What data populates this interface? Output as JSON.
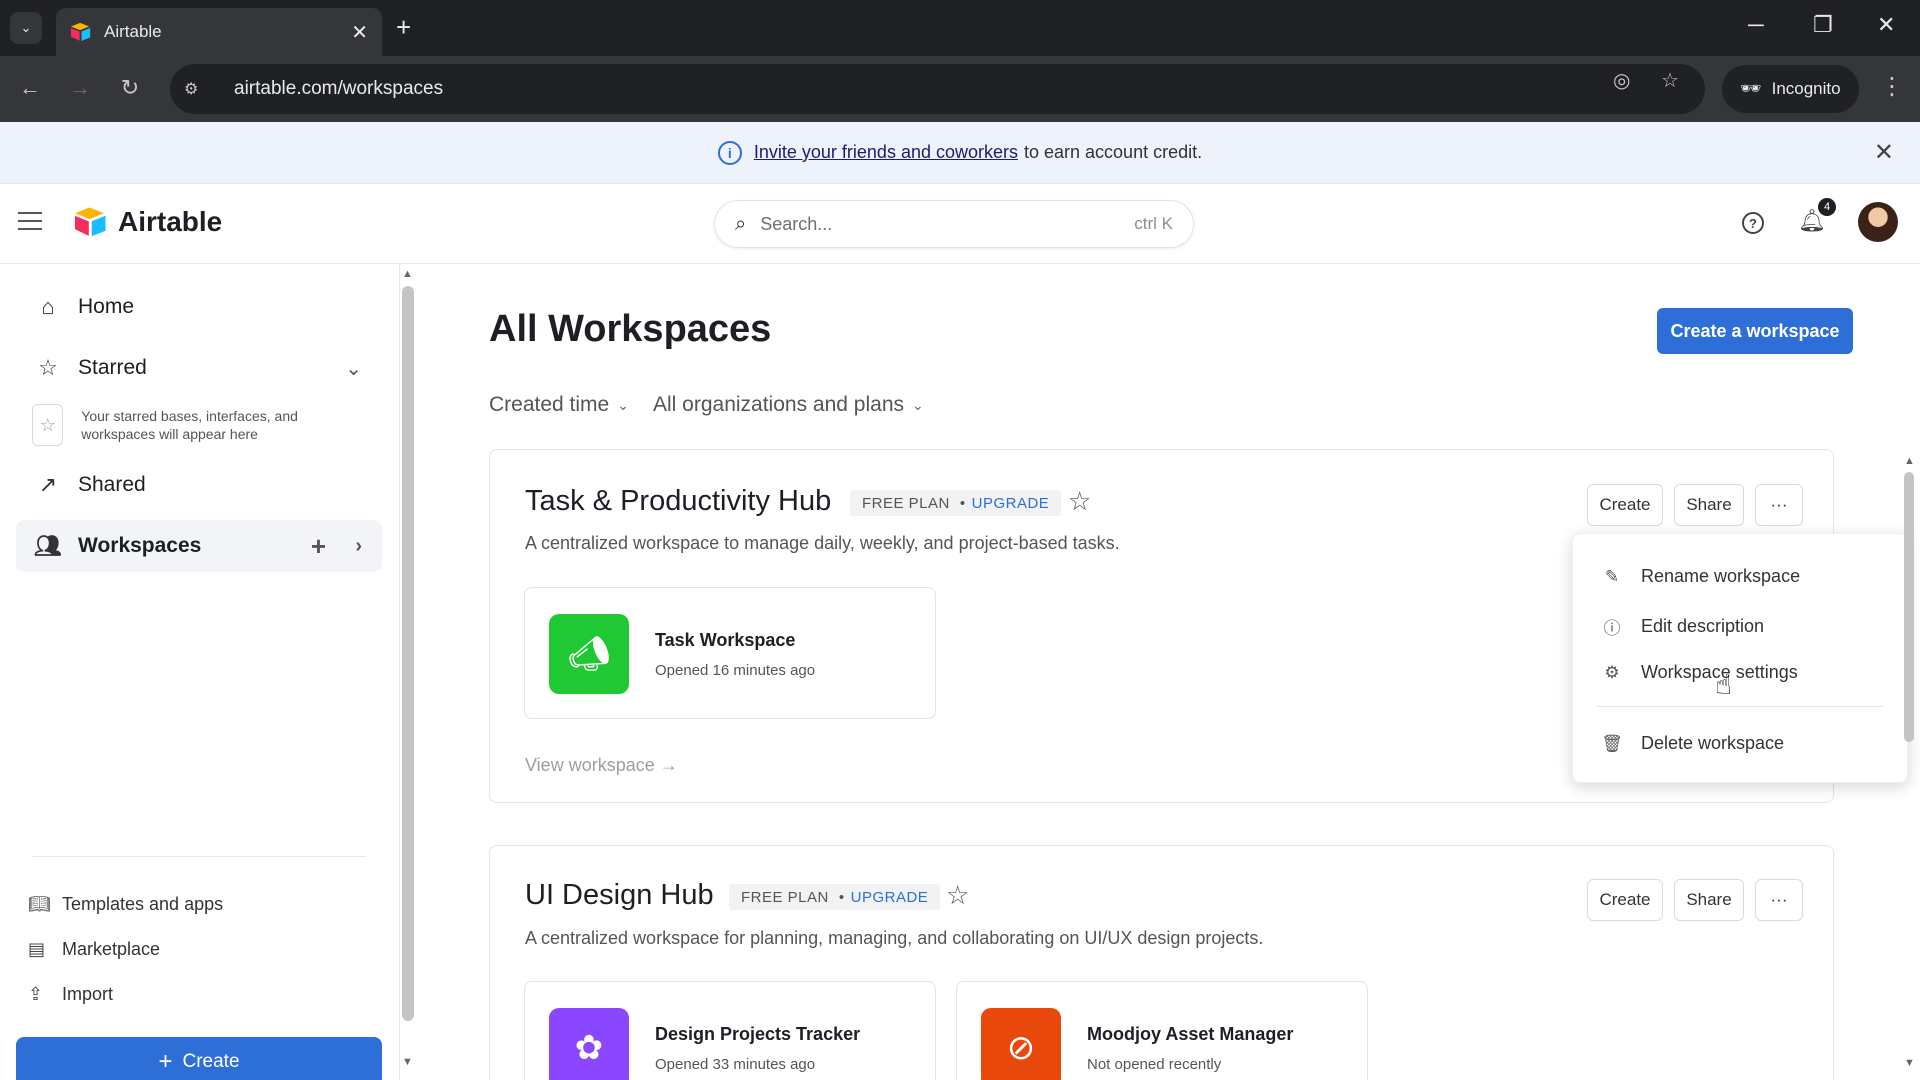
{
  "browser": {
    "tab_title": "Airtable",
    "url": "airtable.com/workspaces",
    "incognito_label": "Incognito"
  },
  "banner": {
    "link_text": "Invite your friends and coworkers",
    "rest_text": "to earn account credit."
  },
  "header": {
    "brand": "Airtable",
    "search_placeholder": "Search...",
    "search_shortcut": "ctrl K",
    "notification_count": "4"
  },
  "sidebar": {
    "home": "Home",
    "starred": "Starred",
    "starred_hint": "Your starred bases, interfaces, and workspaces will appear here",
    "shared": "Shared",
    "workspaces": "Workspaces",
    "templates": "Templates and apps",
    "marketplace": "Marketplace",
    "import": "Import",
    "create": "Create"
  },
  "main": {
    "title": "All Workspaces",
    "create_workspace": "Create a workspace",
    "filter_sort": "Created time",
    "filter_org": "All organizations and plans"
  },
  "workspaces": [
    {
      "name": "Task & Productivity Hub",
      "plan": "FREE PLAN",
      "upgrade": "UPGRADE",
      "description": "A centralized workspace to manage daily, weekly, and project-based tasks.",
      "create_label": "Create",
      "share_label": "Share",
      "more_label": "···",
      "view_label": "View workspace →",
      "bases": [
        {
          "name": "Task Workspace",
          "time": "Opened 16 minutes ago",
          "color": "#20c933",
          "icon": "megaphone-icon"
        }
      ]
    },
    {
      "name": "UI Design Hub",
      "plan": "FREE PLAN",
      "upgrade": "UPGRADE",
      "description": "A centralized workspace for planning, managing, and collaborating on UI/UX design projects.",
      "create_label": "Create",
      "share_label": "Share",
      "more_label": "···",
      "bases": [
        {
          "name": "Design Projects Tracker",
          "time": "Opened 33 minutes ago",
          "color": "#8b46ff",
          "icon": "flower-icon"
        },
        {
          "name": "Moodjoy Asset Manager",
          "time": "Not opened recently",
          "color": "#e8480c",
          "icon": "compass-icon"
        }
      ]
    }
  ],
  "menu": {
    "rename": "Rename workspace",
    "edit_description": "Edit description",
    "settings": "Workspace settings",
    "delete": "Delete workspace"
  },
  "colors": {
    "accent": "#2d6fd6",
    "banner_bg": "#eef2fb"
  }
}
